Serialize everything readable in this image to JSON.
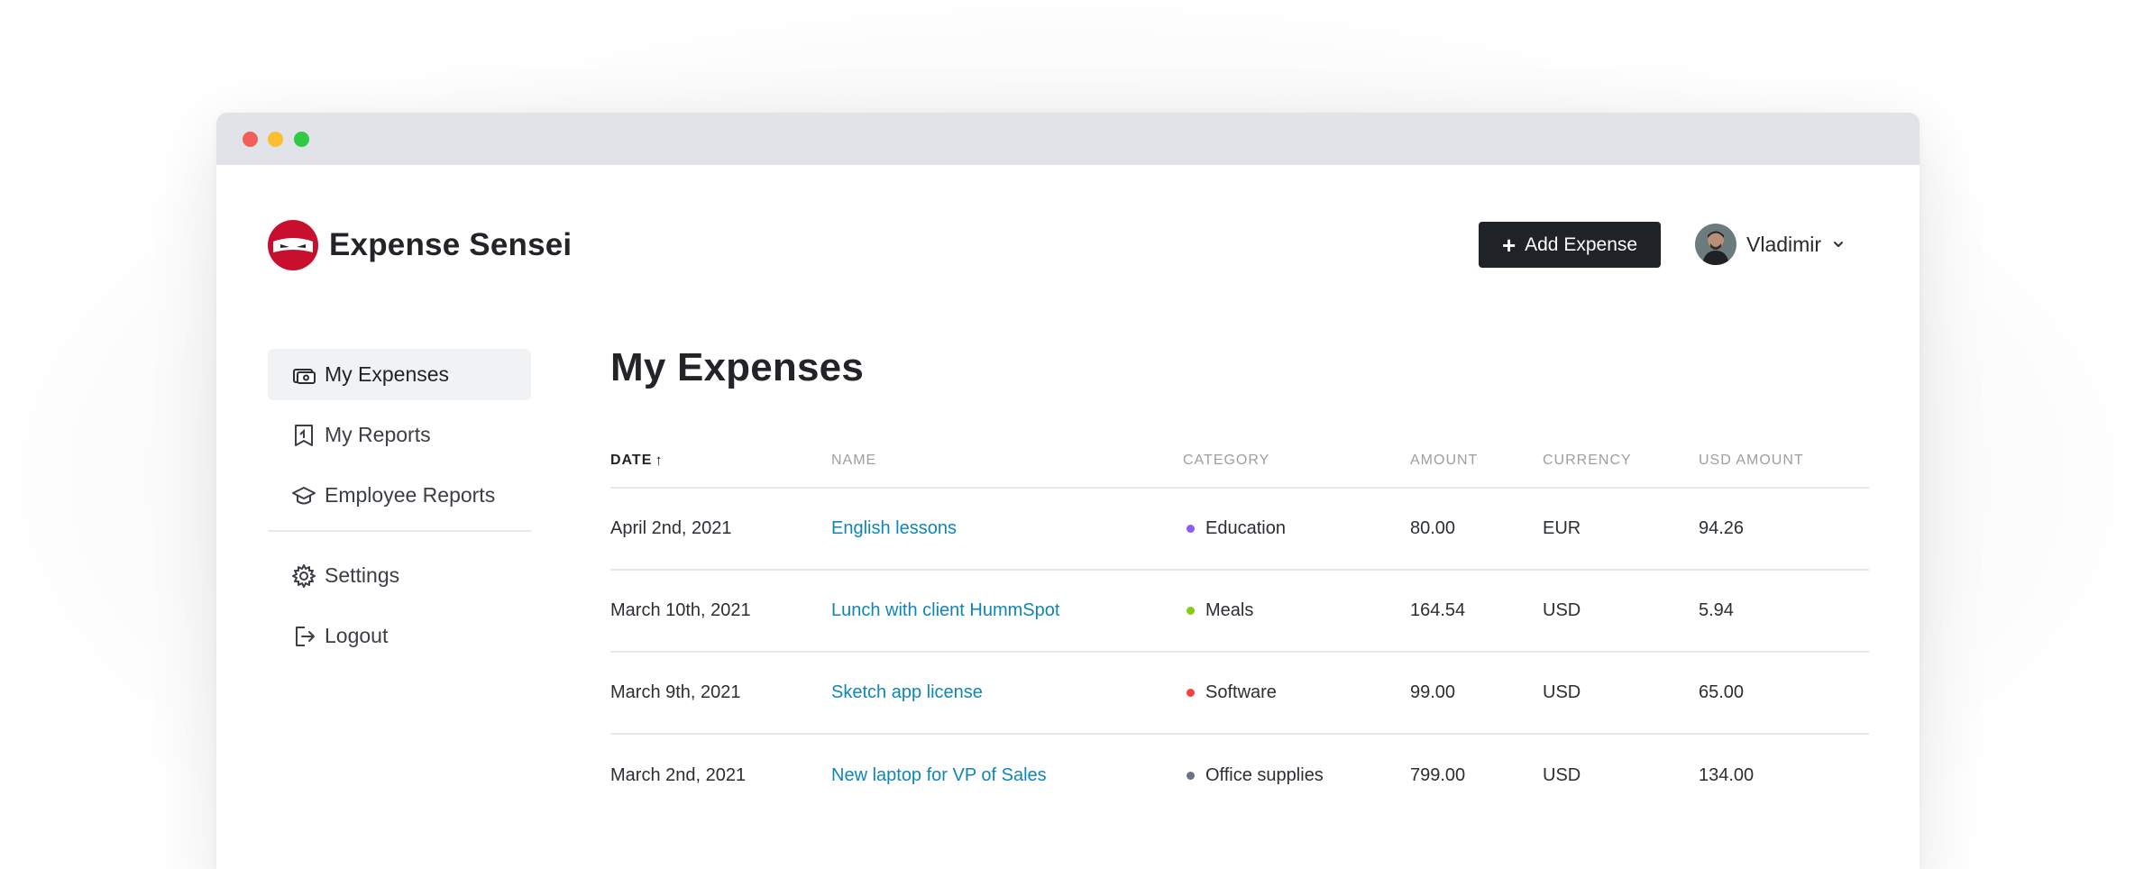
{
  "window": {
    "controls": [
      "close",
      "minimize",
      "zoom"
    ]
  },
  "brand": {
    "name": "Expense Sensei",
    "logo_icon": "ninja-logo-icon",
    "accent_color": "#c8102e"
  },
  "header": {
    "add_button_label": "Add Expense",
    "add_button_icon": "plus-icon",
    "user_name": "Vladimir",
    "user_menu_icon": "chevron-down-icon"
  },
  "sidebar": {
    "items": [
      {
        "label": "My Expenses",
        "icon": "money-stack-icon",
        "active": true
      },
      {
        "label": "My Reports",
        "icon": "report-document-icon",
        "active": false
      },
      {
        "label": "Employee Reports",
        "icon": "graduation-cap-icon",
        "active": false
      }
    ],
    "secondary": [
      {
        "label": "Settings",
        "icon": "gear-icon"
      },
      {
        "label": "Logout",
        "icon": "logout-icon"
      }
    ]
  },
  "main": {
    "title": "My Expenses",
    "table": {
      "columns": [
        {
          "label": "DATE",
          "sorted": "ascending",
          "sort_icon": "arrow-up-icon"
        },
        {
          "label": "NAME"
        },
        {
          "label": "CATEGORY"
        },
        {
          "label": "AMOUNT"
        },
        {
          "label": "CURRENCY"
        },
        {
          "label": "USD AMOUNT"
        }
      ],
      "rows": [
        {
          "date": "April 2nd, 2021",
          "name": "English lessons",
          "category": "Education",
          "category_color": "#8b5cf6",
          "amount": "80.00",
          "currency": "EUR",
          "usd_amount": "94.26"
        },
        {
          "date": "March 10th, 2021",
          "name": "Lunch with client HummSpot",
          "category": "Meals",
          "category_color": "#84cc16",
          "amount": "164.54",
          "currency": "USD",
          "usd_amount": "5.94"
        },
        {
          "date": "March 9th, 2021",
          "name": "Sketch app license",
          "category": "Software",
          "category_color": "#ef4444",
          "amount": "99.00",
          "currency": "USD",
          "usd_amount": "65.00"
        },
        {
          "date": "March 2nd, 2021",
          "name": "New laptop for VP of Sales",
          "category": "Office supplies",
          "category_color": "#6b7280",
          "amount": "799.00",
          "currency": "USD",
          "usd_amount": "134.00"
        }
      ]
    }
  }
}
